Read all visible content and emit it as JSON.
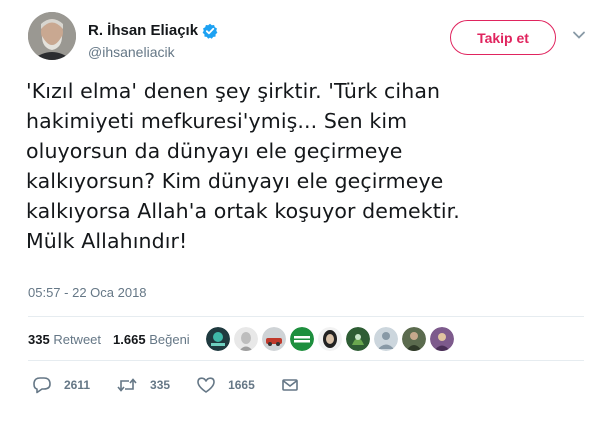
{
  "user": {
    "display_name": "R. İhsan Eliaçık",
    "handle": "@ihsaneliacik",
    "verified": true
  },
  "follow_button": {
    "label": "Takip et",
    "color": "#e0245e"
  },
  "tweet": {
    "text": "'Kızıl elma' denen şey şirktir. 'Türk cihan\nhakimiyeti mefkuresi'ymiş... Sen kim\noluyorsun da dünyayı ele geçirmeye\nkalkıyorsun? Kim dünyayı ele geçirmeye\nkalkıyorsa Allah'a  ortak koşuyor demektir.\nMülk Allahındır!",
    "timestamp": "05:57 - 22 Oca 2018"
  },
  "stats": {
    "retweet_count": "335",
    "retweet_label": "Retweet",
    "like_count": "1.665",
    "like_label": "Beğeni"
  },
  "likers_icons": [
    "avatar-teal",
    "avatar-face-light",
    "avatar-car",
    "avatar-ayaga-kalk",
    "avatar-dark",
    "avatar-green",
    "avatar-default",
    "avatar-person",
    "avatar-purple"
  ],
  "actions": {
    "reply_count": "2611",
    "retweet_count": "335",
    "like_count": "1665"
  },
  "colors": {
    "text": "#14171a",
    "secondary": "#657786",
    "verified": "#1da1f2",
    "divider": "#e6ecf0"
  }
}
